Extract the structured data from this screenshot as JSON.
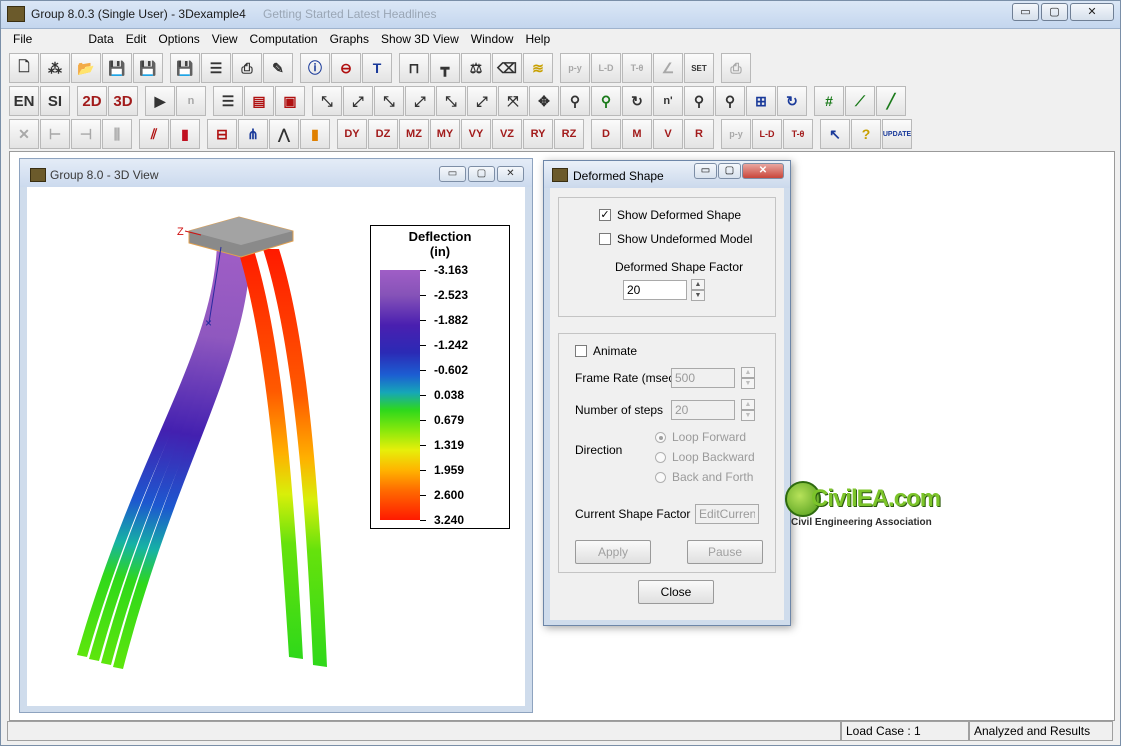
{
  "window": {
    "title": "Group 8.0.3 (Single User) - 3Dexample4",
    "background_tabs": "Getting Started     Latest Headlines",
    "min_label": "▭",
    "max_label": "▢",
    "close_label": "✕"
  },
  "menu": [
    "File",
    "Data",
    "Edit",
    "Options",
    "View",
    "Computation",
    "Graphs",
    "Show 3D View",
    "Window",
    "Help"
  ],
  "toolbar": {
    "row2": {
      "en": "EN",
      "si": "SI",
      "two_d": "2D",
      "three_d": "3D",
      "nc": "n",
      "nc_sub": "L.C.",
      "nc2": "n'"
    },
    "row1": {
      "set": "SET",
      "py": "p-y",
      "ld": "L-D",
      "tq": "T-θ"
    },
    "row3": {
      "dy": "DY",
      "dz": "DZ",
      "mz": "MZ",
      "my": "MY",
      "vy": "VY",
      "vz": "VZ",
      "ry": "RY",
      "rz": "RZ",
      "d": "D",
      "m": "M",
      "v": "V",
      "r": "R",
      "py": "p-y",
      "ld": "L-D",
      "tq": "T-θ",
      "help": "?",
      "update": "UPDATE"
    }
  },
  "view_window": {
    "title": "Group 8.0 - 3D View",
    "axis_z": "Z",
    "legend": {
      "title": "Deflection",
      "unit": "(in)",
      "values": [
        "-3.163",
        "-2.523",
        "-1.882",
        "-1.242",
        "-0.602",
        "0.038",
        "0.679",
        "1.319",
        "1.959",
        "2.600",
        "3.240"
      ]
    }
  },
  "dialog": {
    "title": "Deformed Shape",
    "show_deformed": {
      "label": "Show Deformed Shape",
      "checked": true
    },
    "show_undeformed": {
      "label": "Show Undeformed Model",
      "checked": false
    },
    "factor_label": "Deformed Shape Factor",
    "factor_value": "20",
    "animate": {
      "label": "Animate",
      "checked": false
    },
    "frame_rate_label": "Frame Rate (msec)",
    "frame_rate_value": "500",
    "steps_label": "Number of steps",
    "steps_value": "20",
    "direction_label": "Direction",
    "directions": [
      {
        "label": "Loop Forward",
        "selected": true
      },
      {
        "label": "Loop Backward",
        "selected": false
      },
      {
        "label": "Back and Forth",
        "selected": false
      }
    ],
    "current_factor_label": "Current Shape Factor",
    "current_factor_value": "EditCurrentF",
    "apply_label": "Apply",
    "pause_label": "Pause",
    "close_label": "Close"
  },
  "watermark": {
    "brand": "CivilEA.com",
    "tagline": "Civil Engineering Association"
  },
  "status": {
    "cell1": "",
    "load_case": "Load Case : 1",
    "analysis": "Analyzed and Results"
  }
}
